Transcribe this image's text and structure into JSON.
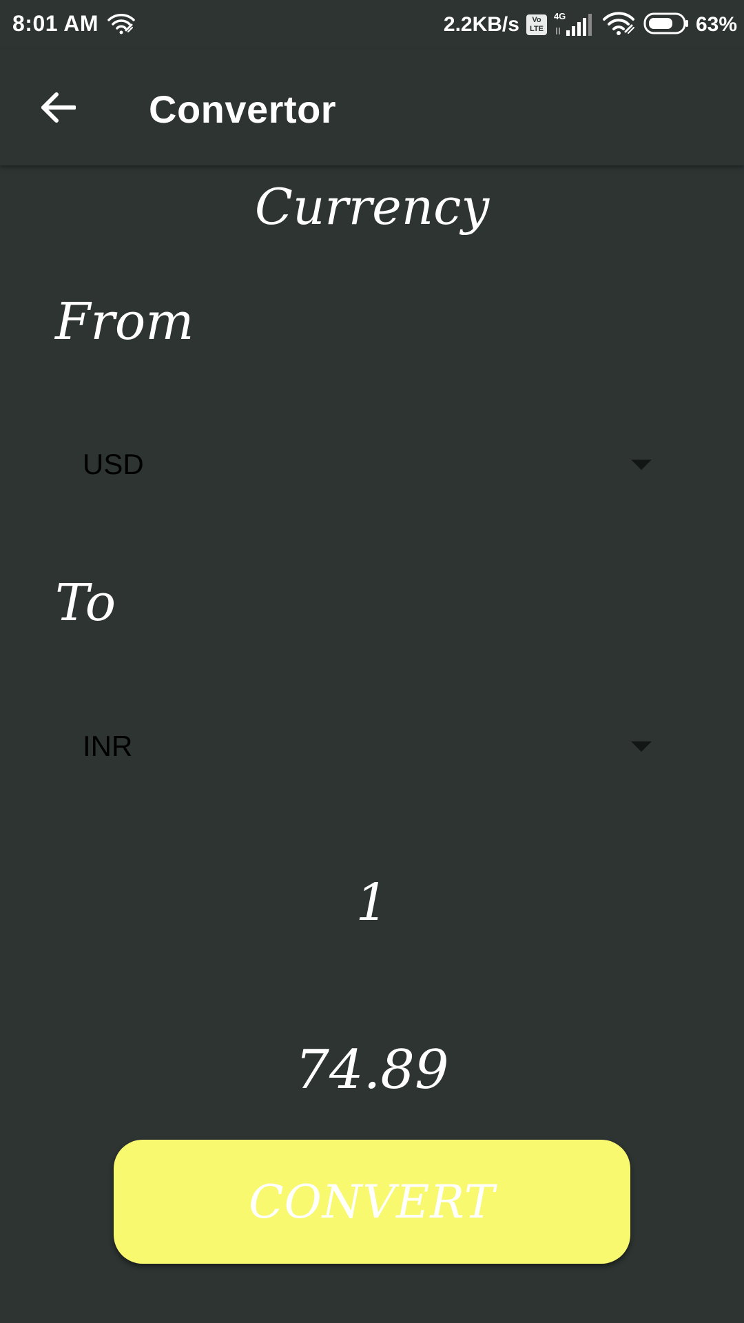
{
  "status_bar": {
    "time": "8:01 AM",
    "speed": "2.2KB/s",
    "volte_top": "Vo",
    "volte_bottom": "LTE",
    "network_type": "4G",
    "battery_percent": "63%"
  },
  "app_bar": {
    "title": "Convertor",
    "back_icon": "arrow-back-icon"
  },
  "main": {
    "section_title": "Currency",
    "from_label": "From",
    "from_value": "USD",
    "to_label": "To",
    "to_value": "INR",
    "amount_value": "1",
    "result_value": "74.89",
    "convert_label": "CONVERT"
  },
  "colors": {
    "background": "#2d3432",
    "button": "#f9f970",
    "text": "#ffffff",
    "spinner_text": "#000000"
  }
}
